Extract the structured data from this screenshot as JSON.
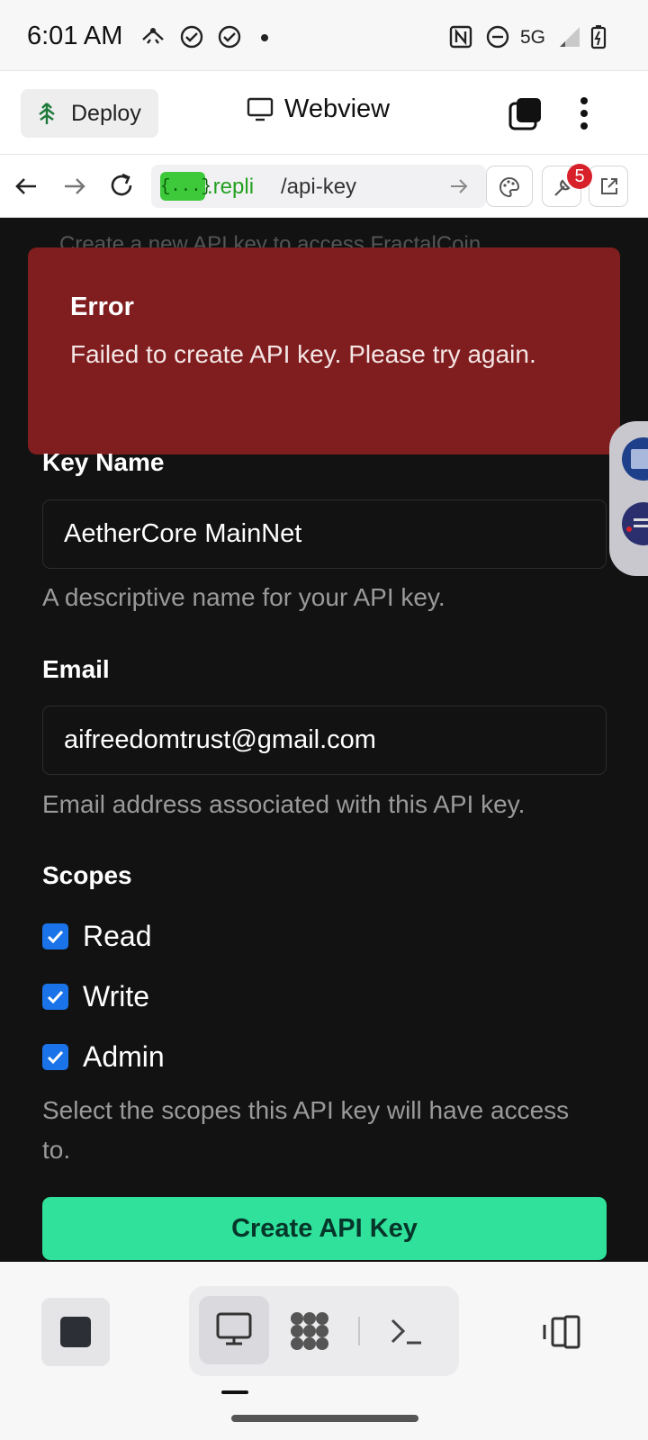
{
  "status_bar": {
    "time": "6:01 AM",
    "network": "5G"
  },
  "app_bar": {
    "deploy_label": "Deploy",
    "title": "Webview"
  },
  "browser": {
    "url_badge": "{...}",
    "url_domain": ".repli",
    "url_path": "/api-key",
    "notification_count": "5"
  },
  "page": {
    "obscured_heading": "Create a new API key to access FractalCoin",
    "error": {
      "title": "Error",
      "message": "Failed to create API key. Please try again."
    },
    "form": {
      "key_name_label": "Key Name",
      "key_name_value": "AetherCore MainNet",
      "key_name_help": "A descriptive name for your API key.",
      "email_label": "Email",
      "email_value": "aifreedomtrust@gmail.com",
      "email_help": "Email address associated with this API key.",
      "scopes_label": "Scopes",
      "scopes": [
        {
          "label": "Read",
          "checked": true
        },
        {
          "label": "Write",
          "checked": true
        },
        {
          "label": "Admin",
          "checked": true
        }
      ],
      "scopes_help": "Select the scopes this API key will have access to.",
      "submit_label": "Create API Key"
    }
  },
  "colors": {
    "error_bg": "#801d1e",
    "accent": "#2fe19a",
    "checkbox": "#1a73e8",
    "page_bg": "#121212"
  },
  "icons": [
    "network-share-icon",
    "check-circle-icon",
    "nfc-icon",
    "dnd-icon",
    "signal-icon",
    "battery-icon",
    "deploy-tree-icon",
    "monitor-icon",
    "tabs-icon",
    "more-vertical-icon",
    "back-arrow-icon",
    "forward-arrow-icon",
    "reload-icon",
    "palette-icon",
    "devtools-icon",
    "open-external-icon",
    "stop-icon",
    "preview-icon",
    "agent-icon",
    "terminal-icon",
    "panel-toggle-icon"
  ]
}
